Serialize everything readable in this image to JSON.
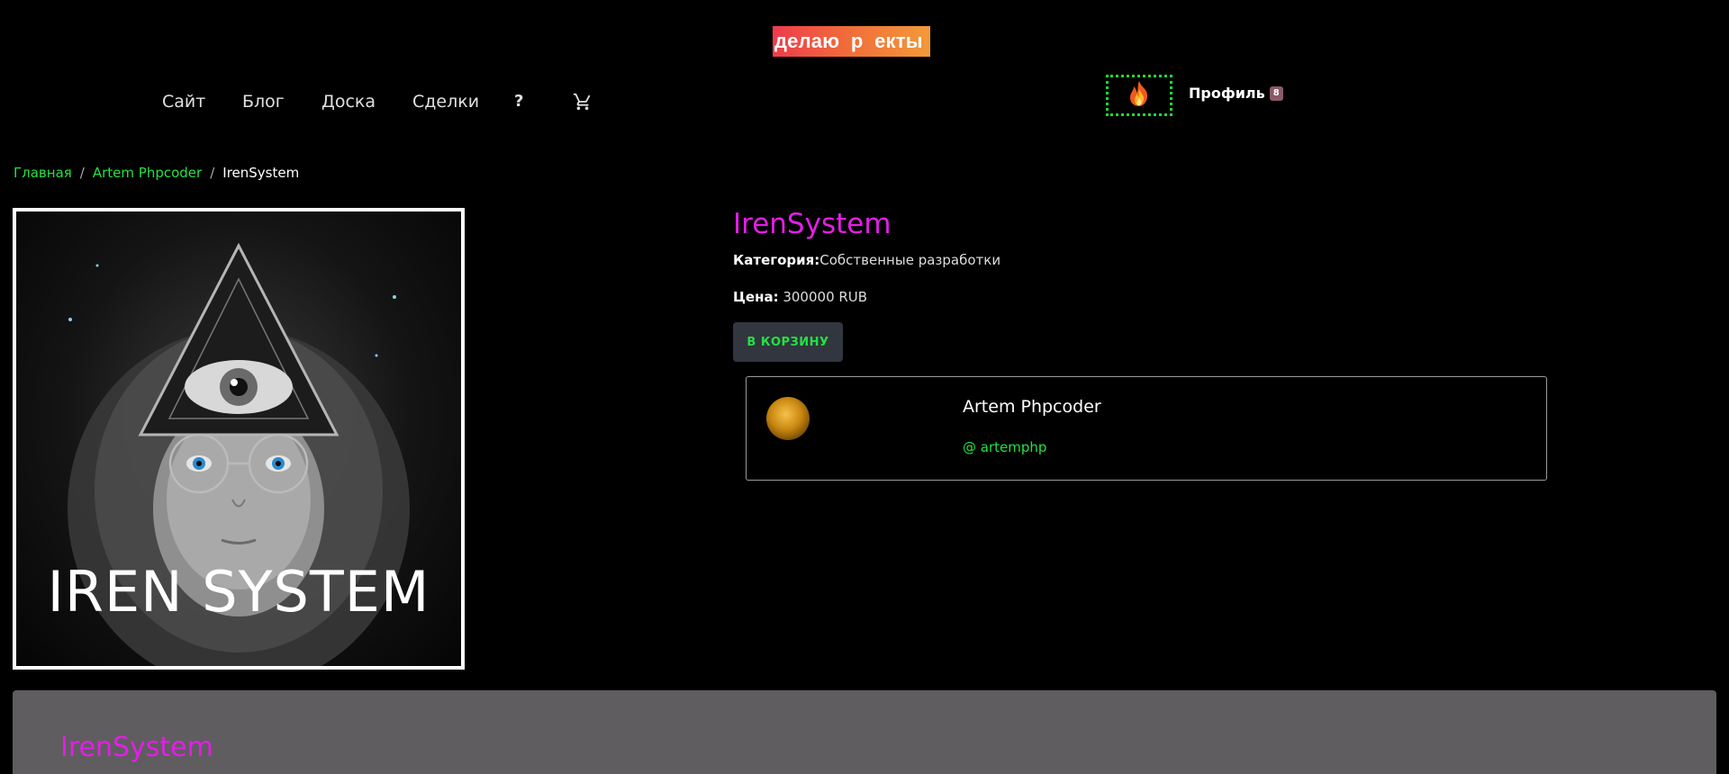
{
  "header": {
    "logo_text": "делаю  р  екты",
    "nav": [
      {
        "label": "Сайт"
      },
      {
        "label": "Блог"
      },
      {
        "label": "Доска"
      },
      {
        "label": "Сделки"
      },
      {
        "label": "?"
      }
    ],
    "cart_icon": "cart-icon",
    "fire_icon": "fire-icon",
    "profile_label": "Профиль",
    "profile_badge": "8"
  },
  "breadcrumb": {
    "items": [
      "Главная",
      "Artem Phpcoder"
    ],
    "current": "IrenSystem"
  },
  "product": {
    "image_caption": "IREN SYSTEM",
    "title": "IrenSystem",
    "category_label": "Категория:",
    "category_value": "Собственные разработки",
    "price_label": "Цена:",
    "price_value": " 300000 RUB",
    "add_to_cart": "В КОРЗИНУ"
  },
  "author": {
    "name": "Artem Phpcoder",
    "handle": "@ artemphp"
  },
  "description": {
    "title": "IrenSystem"
  },
  "colors": {
    "accent_green": "#21e342",
    "title_magenta": "#e21fe6",
    "panel_gray": "#5f5d5f"
  }
}
